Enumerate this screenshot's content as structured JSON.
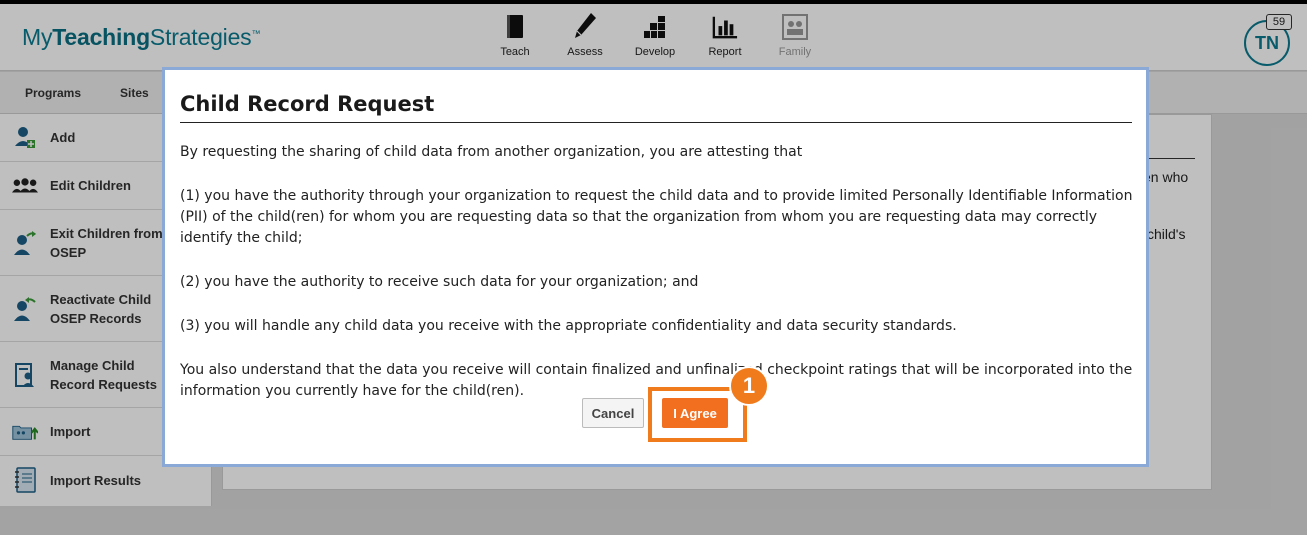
{
  "header": {
    "logo_prefix": "My",
    "logo_bold": "Teaching",
    "logo_suffix": "Strategies",
    "logo_tm": "™",
    "nav": [
      {
        "label": "Teach",
        "icon": "book-icon"
      },
      {
        "label": "Assess",
        "icon": "pencil-icon"
      },
      {
        "label": "Develop",
        "icon": "blocks-icon"
      },
      {
        "label": "Report",
        "icon": "bar-chart-icon"
      },
      {
        "label": "Family",
        "icon": "family-photo-icon"
      }
    ],
    "avatar_initials": "TN",
    "notification_count": "59"
  },
  "subnav": {
    "programs": "Programs",
    "sites": "Sites"
  },
  "sidebar": {
    "items": [
      {
        "label": "Add",
        "icon": "add-child-icon"
      },
      {
        "label": "Edit Children",
        "icon": "group-icon"
      },
      {
        "label": "Exit Children from OSEP",
        "icon": "exit-child-icon"
      },
      {
        "label": "Reactivate Child OSEP Records",
        "icon": "reactivate-child-icon"
      },
      {
        "label": "Manage Child Record Requests",
        "icon": "record-request-icon"
      },
      {
        "label": "Import",
        "icon": "import-folder-icon"
      },
      {
        "label": "Import Results",
        "icon": "notebook-icon"
      }
    ]
  },
  "content": {
    "fragment1": "en who",
    "fragment2": "child's"
  },
  "modal": {
    "title": "Child Record Request",
    "paragraphs": [
      "By requesting the sharing of child data from another organization, you are attesting that",
      "(1) you have the authority through your organization to request the child data and to provide limited Personally Identifiable Information (PII) of the child(ren) for whom you are requesting data so that the organization from whom you are requesting data may correctly identify the child;",
      "(2) you have the authority to receive such data for your organization; and",
      "(3) you will handle any child data you receive with the appropriate confidentiality and data security standards.",
      "You also understand that the data you receive will contain finalized and unfinalized checkpoint ratings that will be incorporated into the information you currently have for the child(ren)."
    ],
    "cancel_label": "Cancel",
    "agree_label": "I Agree"
  },
  "annotation": {
    "step_number": "1",
    "accent_color": "#f07b1c"
  }
}
